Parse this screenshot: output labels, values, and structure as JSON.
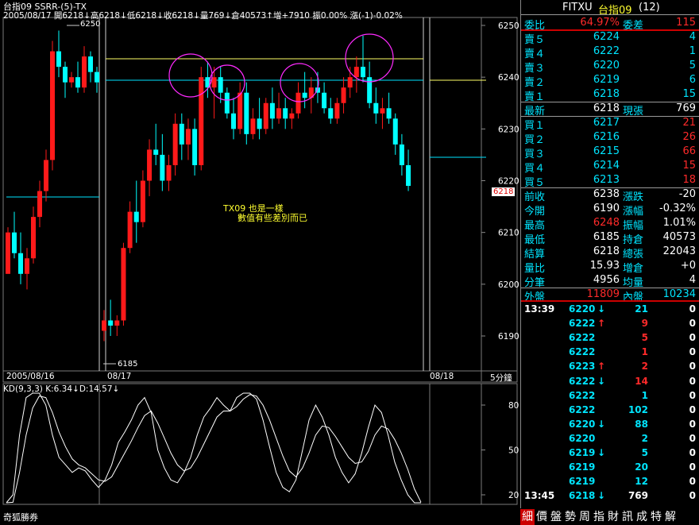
{
  "header": {
    "line1": "台指09 SSRR-(5)-TX",
    "line2": "2005/08/17 開6218↓高6218↓低6218↓收6218↓量769↓倉40573↑增+7910 振0.00% 漲(-1)-0.02%",
    "high_marker": "6250",
    "low_marker": "6185",
    "price_box": "6218"
  },
  "annotation": {
    "line1": "TX09 也是一樣",
    "line2": "數值有些差別而已"
  },
  "kd_header": "KD(9,3,3) K:6.34↓D:14.57↓",
  "footer_left": "奇狐勝券",
  "chart_data": {
    "type": "candlestick",
    "ylim": [
      6187,
      6254
    ],
    "yticks": [
      6190,
      6200,
      6210,
      6220,
      6230,
      6240,
      6250
    ],
    "xlabels": [
      "2005/08/16",
      "08/17",
      "08/18"
    ],
    "period_label": "5分鐘",
    "candles": [
      [
        6202,
        6211,
        6202,
        6210
      ],
      [
        6210,
        6214,
        6205,
        6206
      ],
      [
        6206,
        6210,
        6200,
        6202
      ],
      [
        6202,
        6207,
        6199,
        6205
      ],
      [
        6205,
        6215,
        6204,
        6213
      ],
      [
        6213,
        6220,
        6211,
        6218
      ],
      [
        6218,
        6226,
        6216,
        6224
      ],
      [
        6224,
        6247,
        6222,
        6245
      ],
      [
        6245,
        6249,
        6240,
        6242
      ],
      [
        6242,
        6243,
        6236,
        6239
      ],
      [
        6239,
        6241,
        6238,
        6240
      ],
      [
        6240,
        6243,
        6237,
        6238
      ],
      [
        6238,
        6246,
        6237,
        6244
      ],
      [
        6244,
        6245,
        6239,
        6241
      ],
      [
        6241,
        6242,
        6237,
        6239
      ],
      [
        6191,
        6195,
        6189,
        6193
      ],
      [
        6193,
        6197,
        6190,
        6192
      ],
      [
        6192,
        6194,
        6190,
        6193
      ],
      [
        6193,
        6208,
        6192,
        6207
      ],
      [
        6207,
        6216,
        6206,
        6214
      ],
      [
        6214,
        6220,
        6208,
        6212
      ],
      [
        6212,
        6222,
        6211,
        6220
      ],
      [
        6220,
        6228,
        6217,
        6226
      ],
      [
        6226,
        6231,
        6223,
        6225
      ],
      [
        6225,
        6229,
        6218,
        6220
      ],
      [
        6220,
        6225,
        6218,
        6223
      ],
      [
        6223,
        6233,
        6221,
        6231
      ],
      [
        6231,
        6233,
        6224,
        6227
      ],
      [
        6227,
        6232,
        6224,
        6230
      ],
      [
        6230,
        6232,
        6221,
        6223
      ],
      [
        6223,
        6242,
        6222,
        6240
      ],
      [
        6240,
        6243,
        6236,
        6238
      ],
      [
        6238,
        6242,
        6232,
        6240
      ],
      [
        6240,
        6242,
        6235,
        6237
      ],
      [
        6237,
        6238,
        6232,
        6233
      ],
      [
        6233,
        6236,
        6228,
        6230
      ],
      [
        6230,
        6239,
        6229,
        6237
      ],
      [
        6237,
        6239,
        6227,
        6229
      ],
      [
        6229,
        6234,
        6228,
        6232
      ],
      [
        6232,
        6236,
        6228,
        6230
      ],
      [
        6230,
        6236,
        6229,
        6235
      ],
      [
        6235,
        6238,
        6230,
        6232
      ],
      [
        6232,
        6237,
        6231,
        6234
      ],
      [
        6234,
        6236,
        6230,
        6232
      ],
      [
        6232,
        6234,
        6230,
        6233
      ],
      [
        6233,
        6239,
        6232,
        6237
      ],
      [
        6237,
        6241,
        6234,
        6236
      ],
      [
        6236,
        6240,
        6233,
        6238
      ],
      [
        6238,
        6241,
        6235,
        6237
      ],
      [
        6237,
        6239,
        6233,
        6234
      ],
      [
        6234,
        6236,
        6231,
        6232
      ],
      [
        6232,
        6236,
        6231,
        6235
      ],
      [
        6235,
        6240,
        6233,
        6238
      ],
      [
        6238,
        6242,
        6236,
        6240
      ],
      [
        6240,
        6244,
        6237,
        6242
      ],
      [
        6242,
        6248,
        6239,
        6240
      ],
      [
        6240,
        6243,
        6234,
        6235
      ],
      [
        6235,
        6238,
        6231,
        6233
      ],
      [
        6233,
        6236,
        6230,
        6234
      ],
      [
        6234,
        6237,
        6231,
        6232
      ],
      [
        6232,
        6233,
        6225,
        6227
      ],
      [
        6227,
        6229,
        6221,
        6223
      ],
      [
        6223,
        6226,
        6218,
        6219
      ]
    ],
    "kd": {
      "yticks": [
        20,
        50,
        80
      ],
      "k": [
        5,
        20,
        60,
        85,
        92,
        90,
        80,
        60,
        45,
        40,
        35,
        38,
        36,
        30,
        25,
        30,
        40,
        55,
        62,
        70,
        80,
        85,
        75,
        50,
        38,
        30,
        28,
        35,
        45,
        60,
        72,
        78,
        85,
        80,
        76,
        85,
        90,
        88,
        84,
        70,
        52,
        35,
        25,
        22,
        30,
        50,
        70,
        80,
        72,
        60,
        45,
        35,
        28,
        34,
        48,
        65,
        80,
        75,
        60,
        42,
        30,
        20,
        12,
        6
      ],
      "d": [
        10,
        15,
        35,
        60,
        78,
        86,
        85,
        75,
        62,
        52,
        44,
        40,
        38,
        34,
        30,
        29,
        32,
        40,
        48,
        56,
        65,
        73,
        76,
        68,
        58,
        48,
        40,
        36,
        38,
        45,
        54,
        63,
        72,
        76,
        76,
        79,
        84,
        87,
        86,
        80,
        70,
        58,
        46,
        36,
        32,
        38,
        48,
        60,
        66,
        65,
        59,
        52,
        45,
        41,
        42,
        49,
        60,
        66,
        64,
        57,
        48,
        37,
        24,
        15
      ]
    }
  },
  "panel": {
    "title_sym": "FITXU",
    "title_name": "台指09",
    "title_count": "(12)",
    "ratio": {
      "label": "委比",
      "value": "64.97%",
      "label2": "委差",
      "value2": "115"
    },
    "asks": [
      {
        "label": "賣５",
        "price": "6224",
        "qty": "4"
      },
      {
        "label": "賣４",
        "price": "6222",
        "qty": "1"
      },
      {
        "label": "賣３",
        "price": "6220",
        "qty": "5"
      },
      {
        "label": "賣２",
        "price": "6219",
        "qty": "6"
      },
      {
        "label": "賣１",
        "price": "6218",
        "qty": "15"
      }
    ],
    "last": {
      "label": "最新",
      "price": "6218",
      "label2": "現張",
      "qty": "769"
    },
    "bids": [
      {
        "label": "買１",
        "price": "6217",
        "qty": "21"
      },
      {
        "label": "買２",
        "price": "6216",
        "qty": "26"
      },
      {
        "label": "買３",
        "price": "6215",
        "qty": "66"
      },
      {
        "label": "買４",
        "price": "6214",
        "qty": "15"
      },
      {
        "label": "買５",
        "price": "6213",
        "qty": "18"
      }
    ],
    "stats": [
      {
        "l1": "前收",
        "v1": "6238",
        "c1": "white",
        "l2": "漲跌",
        "v2": "-20"
      },
      {
        "l1": "今開",
        "v1": "6190",
        "c1": "white",
        "l2": "漲幅",
        "v2": "-0.32%"
      },
      {
        "l1": "最高",
        "v1": "6248",
        "c1": "red",
        "l2": "振幅",
        "v2": "1.01%"
      },
      {
        "l1": "最低",
        "v1": "6185",
        "c1": "white",
        "l2": "持倉",
        "v2": "40573"
      },
      {
        "l1": "結算",
        "v1": "6218",
        "c1": "white",
        "l2": "總張",
        "v2": "22043"
      },
      {
        "l1": "量比",
        "v1": "15.93",
        "c1": "white",
        "l2": "增倉",
        "v2": "+0"
      },
      {
        "l1": "分筆",
        "v1": "4956",
        "c1": "white",
        "l2": "均量",
        "v2": "4"
      }
    ],
    "outer": {
      "label": "外盤",
      "value": "11809",
      "label2": "內盤",
      "value2": "10234"
    },
    "ticks": [
      {
        "time": "13:39",
        "price": "6220",
        "arrow": "↓",
        "acolor": "cyan",
        "qty": "21",
        "qcolor": "cyan",
        "n": "0"
      },
      {
        "time": "",
        "price": "6222",
        "arrow": "↑",
        "acolor": "red",
        "qty": "9",
        "qcolor": "red",
        "n": "0"
      },
      {
        "time": "",
        "price": "6222",
        "arrow": "",
        "acolor": "",
        "qty": "5",
        "qcolor": "red",
        "n": "0"
      },
      {
        "time": "",
        "price": "6222",
        "arrow": "",
        "acolor": "",
        "qty": "1",
        "qcolor": "red",
        "n": "0"
      },
      {
        "time": "",
        "price": "6223",
        "arrow": "↑",
        "acolor": "red",
        "qty": "2",
        "qcolor": "red",
        "n": "0"
      },
      {
        "time": "",
        "price": "6222",
        "arrow": "↓",
        "acolor": "cyan",
        "qty": "14",
        "qcolor": "red",
        "n": "0"
      },
      {
        "time": "",
        "price": "6222",
        "arrow": "",
        "acolor": "",
        "qty": "1",
        "qcolor": "cyan",
        "n": "0"
      },
      {
        "time": "",
        "price": "6222",
        "arrow": "",
        "acolor": "",
        "qty": "102",
        "qcolor": "cyan",
        "n": "0"
      },
      {
        "time": "",
        "price": "6220",
        "arrow": "↓",
        "acolor": "cyan",
        "qty": "88",
        "qcolor": "cyan",
        "n": "0"
      },
      {
        "time": "",
        "price": "6220",
        "arrow": "",
        "acolor": "",
        "qty": "2",
        "qcolor": "cyan",
        "n": "0"
      },
      {
        "time": "",
        "price": "6219",
        "arrow": "↓",
        "acolor": "cyan",
        "qty": "5",
        "qcolor": "cyan",
        "n": "0"
      },
      {
        "time": "",
        "price": "6219",
        "arrow": "",
        "acolor": "",
        "qty": "20",
        "qcolor": "cyan",
        "n": "0"
      },
      {
        "time": "",
        "price": "6219",
        "arrow": "",
        "acolor": "",
        "qty": "12",
        "qcolor": "cyan",
        "n": "0"
      },
      {
        "time": "13:45",
        "price": "6218",
        "arrow": "↓",
        "acolor": "cyan",
        "qty": "769",
        "qcolor": "white",
        "n": "0"
      }
    ],
    "bottom_tabs": [
      "細",
      "價",
      "盤",
      "勢",
      "周",
      "指",
      "財",
      "訊",
      "成",
      "特",
      "解"
    ]
  },
  "colors": {
    "up": "#ff1a1a",
    "down": "#00ffff",
    "circle": "#ff2aff",
    "yellow_line": "#ffff66"
  }
}
